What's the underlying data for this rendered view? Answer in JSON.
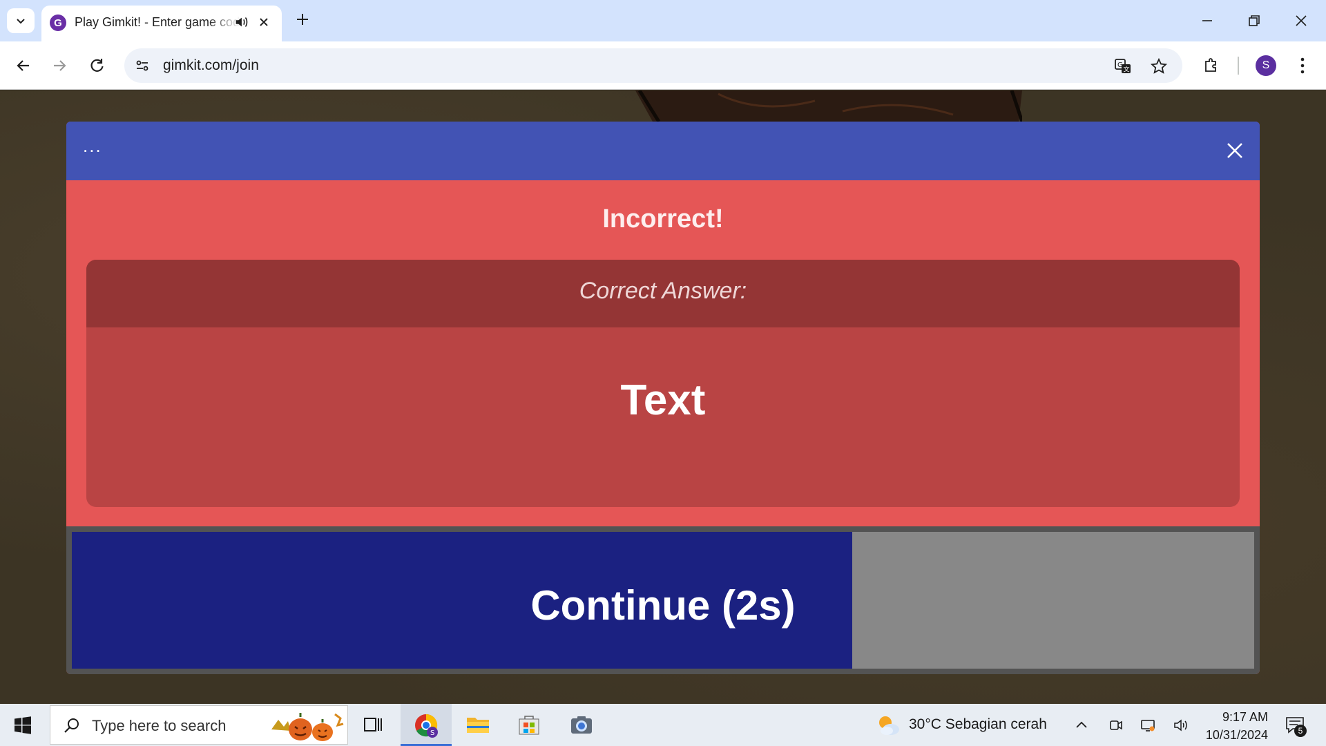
{
  "browser": {
    "tab_title": "Play Gimkit! - Enter game code",
    "url": "gimkit.com/join",
    "favicon_letter": "G",
    "profile_initial": "S"
  },
  "modal": {
    "dots": "...",
    "title": "Incorrect!",
    "answer_label": "Correct Answer:",
    "answer_value": "Text",
    "continue_label": "Continue (2s)",
    "continue_progress": 0.66
  },
  "taskbar": {
    "search_placeholder": "Type here to search",
    "weather": "30°C  Sebagian cerah",
    "time": "9:17 AM",
    "date": "10/31/2024",
    "notification_count": "5"
  },
  "colors": {
    "header": "#4253b4",
    "modal": "#e55656",
    "answer_box": "#b94444",
    "answer_head": "#943535",
    "continue_fill": "#1b2181"
  }
}
